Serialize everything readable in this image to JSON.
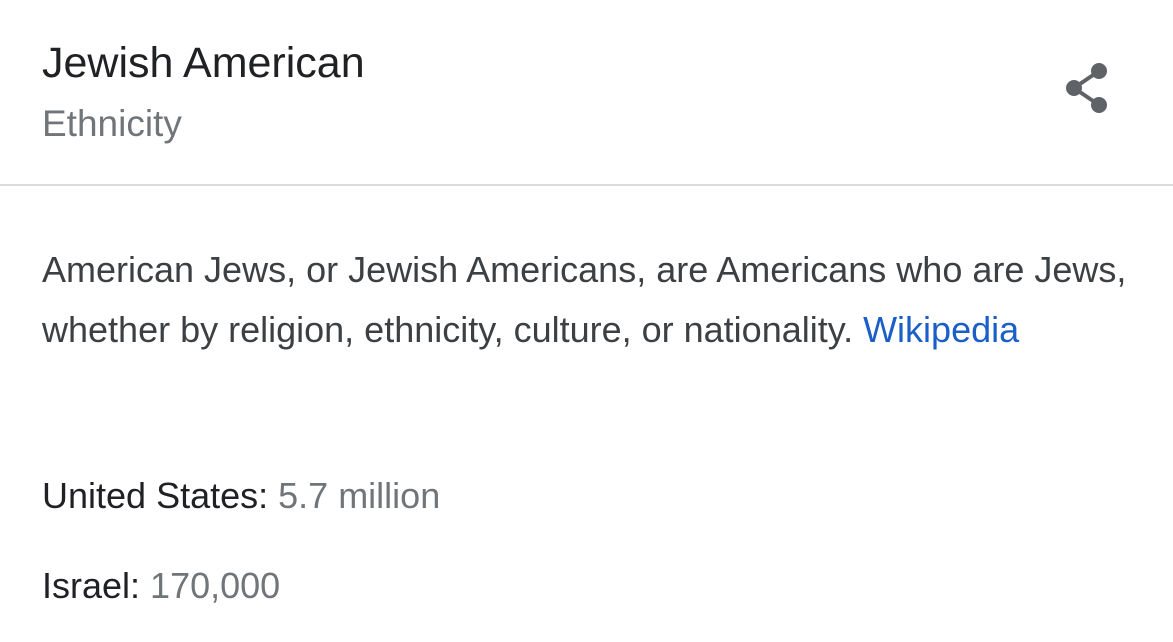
{
  "header": {
    "title": "Jewish American",
    "subtitle": "Ethnicity",
    "share_icon": "share-icon"
  },
  "description": {
    "text": "American Jews, or Jewish Americans, are Americans who are Jews, whether by religion, ethnicity, culture, or nationality.",
    "source_link": "Wikipedia"
  },
  "facts": [
    {
      "label": "United States:",
      "value": "5.7 million"
    },
    {
      "label": "Israel:",
      "value": "170,000"
    }
  ],
  "colors": {
    "title": "#202124",
    "secondary": "#70757a",
    "body_text": "#3c4043",
    "link": "#1a5fc8",
    "divider": "#dadce0",
    "icon": "#5f6368"
  }
}
